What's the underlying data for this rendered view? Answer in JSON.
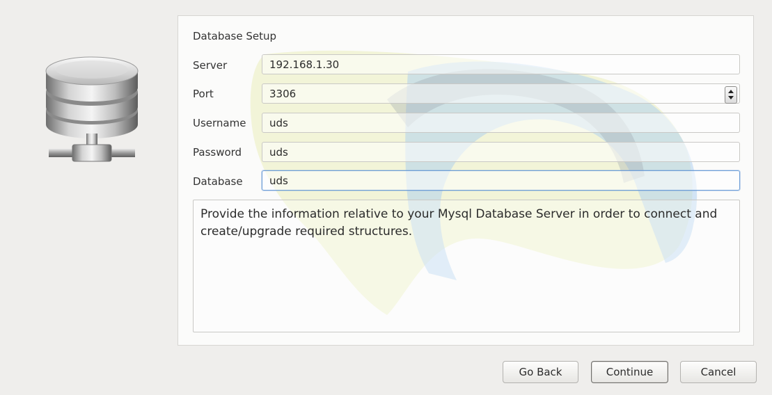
{
  "section_title": "Database Setup",
  "fields": {
    "server": {
      "label": "Server",
      "value": "192.168.1.30"
    },
    "port": {
      "label": "Port",
      "value": "3306"
    },
    "username": {
      "label": "Username",
      "value": "uds"
    },
    "password": {
      "label": "Password",
      "value": "uds"
    },
    "database": {
      "label": "Database",
      "value": "uds"
    }
  },
  "info_text": "Provide the information relative to your Mysql Database Server in order to connect and create/upgrade required structures.",
  "buttons": {
    "back": "Go Back",
    "continue": "Continue",
    "cancel": "Cancel"
  },
  "icons": {
    "database": "database-server-icon",
    "spinner": "spin-buttons-icon",
    "watermark": "logo-watermark"
  },
  "colors": {
    "focus_border": "#6f9fd8",
    "background": "#efeeec",
    "panel": "#fbfbfa"
  }
}
